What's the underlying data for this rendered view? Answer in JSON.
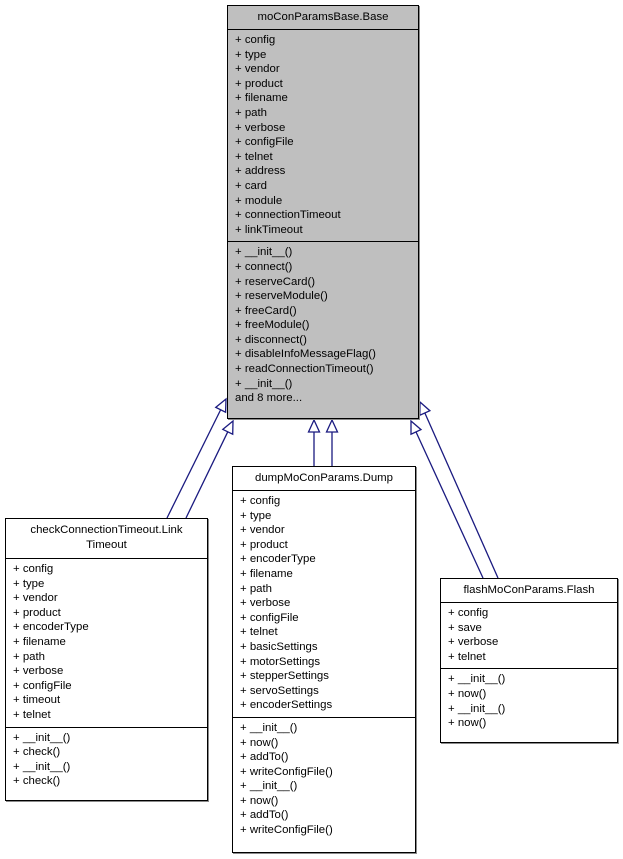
{
  "diagram": {
    "type": "uml-class-inheritance",
    "edge_color": "#1a1a80",
    "base_fill": "#bfbfbf",
    "derived_fill": "#ffffff",
    "classes": {
      "base": {
        "name": "moConParamsBase.Base",
        "attributes": [
          "+ config",
          "+ type",
          "+ vendor",
          "+ product",
          "+ filename",
          "+ path",
          "+ verbose",
          "+ configFile",
          "+ telnet",
          "+ address",
          "+ card",
          "+ module",
          "+ connectionTimeout",
          "+ linkTimeout"
        ],
        "methods": [
          "+ __init__()",
          "+ connect()",
          "+ reserveCard()",
          "+ reserveModule()",
          "+ freeCard()",
          "+ freeModule()",
          "+ disconnect()",
          "+ disableInfoMessageFlag()",
          "+ readConnectionTimeout()",
          "+ __init__()",
          "and 8 more..."
        ]
      },
      "link": {
        "name": "checkConnectionTimeout.Link Timeout",
        "attributes": [
          "+ config",
          "+ type",
          "+ vendor",
          "+ product",
          "+ encoderType",
          "+ filename",
          "+ path",
          "+ verbose",
          "+ configFile",
          "+ timeout",
          "+ telnet"
        ],
        "methods": [
          "+ __init__()",
          "+ check()",
          "+ __init__()",
          "+ check()"
        ]
      },
      "dump": {
        "name": "dumpMoConParams.Dump",
        "attributes": [
          "+ config",
          "+ type",
          "+ vendor",
          "+ product",
          "+ encoderType",
          "+ filename",
          "+ path",
          "+ verbose",
          "+ configFile",
          "+ telnet",
          "+ basicSettings",
          "+ motorSettings",
          "+ stepperSettings",
          "+ servoSettings",
          "+ encoderSettings"
        ],
        "methods": [
          "+ __init__()",
          "+ now()",
          "+ addTo()",
          "+ writeConfigFile()",
          "+ __init__()",
          "+ now()",
          "+ addTo()",
          "+ writeConfigFile()"
        ]
      },
      "flash": {
        "name": "flashMoConParams.Flash",
        "attributes": [
          "+ config",
          "+ save",
          "+ verbose",
          "+ telnet"
        ],
        "methods": [
          "+ __init__()",
          "+ now()",
          "+ __init__()",
          "+ now()"
        ]
      }
    },
    "edges": [
      {
        "from": "link",
        "to": "base",
        "kind": "inheritance"
      },
      {
        "from": "link",
        "to": "base",
        "kind": "inheritance"
      },
      {
        "from": "dump",
        "to": "base",
        "kind": "inheritance"
      },
      {
        "from": "dump",
        "to": "base",
        "kind": "inheritance"
      },
      {
        "from": "flash",
        "to": "base",
        "kind": "inheritance"
      },
      {
        "from": "flash",
        "to": "base",
        "kind": "inheritance"
      }
    ]
  }
}
